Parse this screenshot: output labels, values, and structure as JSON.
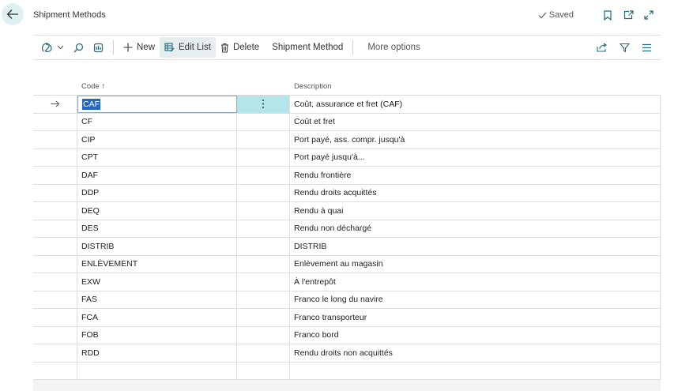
{
  "page": {
    "title": "Shipment Methods",
    "saved_label": "Saved"
  },
  "toolbar": {
    "new_label": "New",
    "edit_list_label": "Edit List",
    "delete_label": "Delete",
    "shipment_method_label": "Shipment Method",
    "more_options_label": "More options"
  },
  "grid": {
    "code_header": "Code ↑",
    "description_header": "Description",
    "rows": [
      {
        "code": "CAF",
        "description": "Coût, assurance et fret (CAF)"
      },
      {
        "code": "CF",
        "description": "Coût et fret"
      },
      {
        "code": "CIP",
        "description": "Port payé, ass. compr. jusqu'à"
      },
      {
        "code": "CPT",
        "description": "Port payé jusqu'à..."
      },
      {
        "code": "DAF",
        "description": "Rendu frontière"
      },
      {
        "code": "DDP",
        "description": "Rendu droits acquittés"
      },
      {
        "code": "DEQ",
        "description": "Rendu à quai"
      },
      {
        "code": "DES",
        "description": "Rendu non déchargé"
      },
      {
        "code": "DISTRIB",
        "description": "DISTRIB"
      },
      {
        "code": "ENLÈVEMENT",
        "description": "Enlèvement au magasin"
      },
      {
        "code": "EXW",
        "description": "À l'entrepôt"
      },
      {
        "code": "FAS",
        "description": "Franco le long du navire"
      },
      {
        "code": "FCA",
        "description": "Franco transporteur"
      },
      {
        "code": "FOB",
        "description": "Franco bord"
      },
      {
        "code": "RDD",
        "description": "Rendu droits non acquittés"
      }
    ]
  },
  "colors": {
    "accent": "#2266cc",
    "selected_menu": "#b4e5ea",
    "back_button": "#dff0f1",
    "icon": "#1d6a82"
  }
}
